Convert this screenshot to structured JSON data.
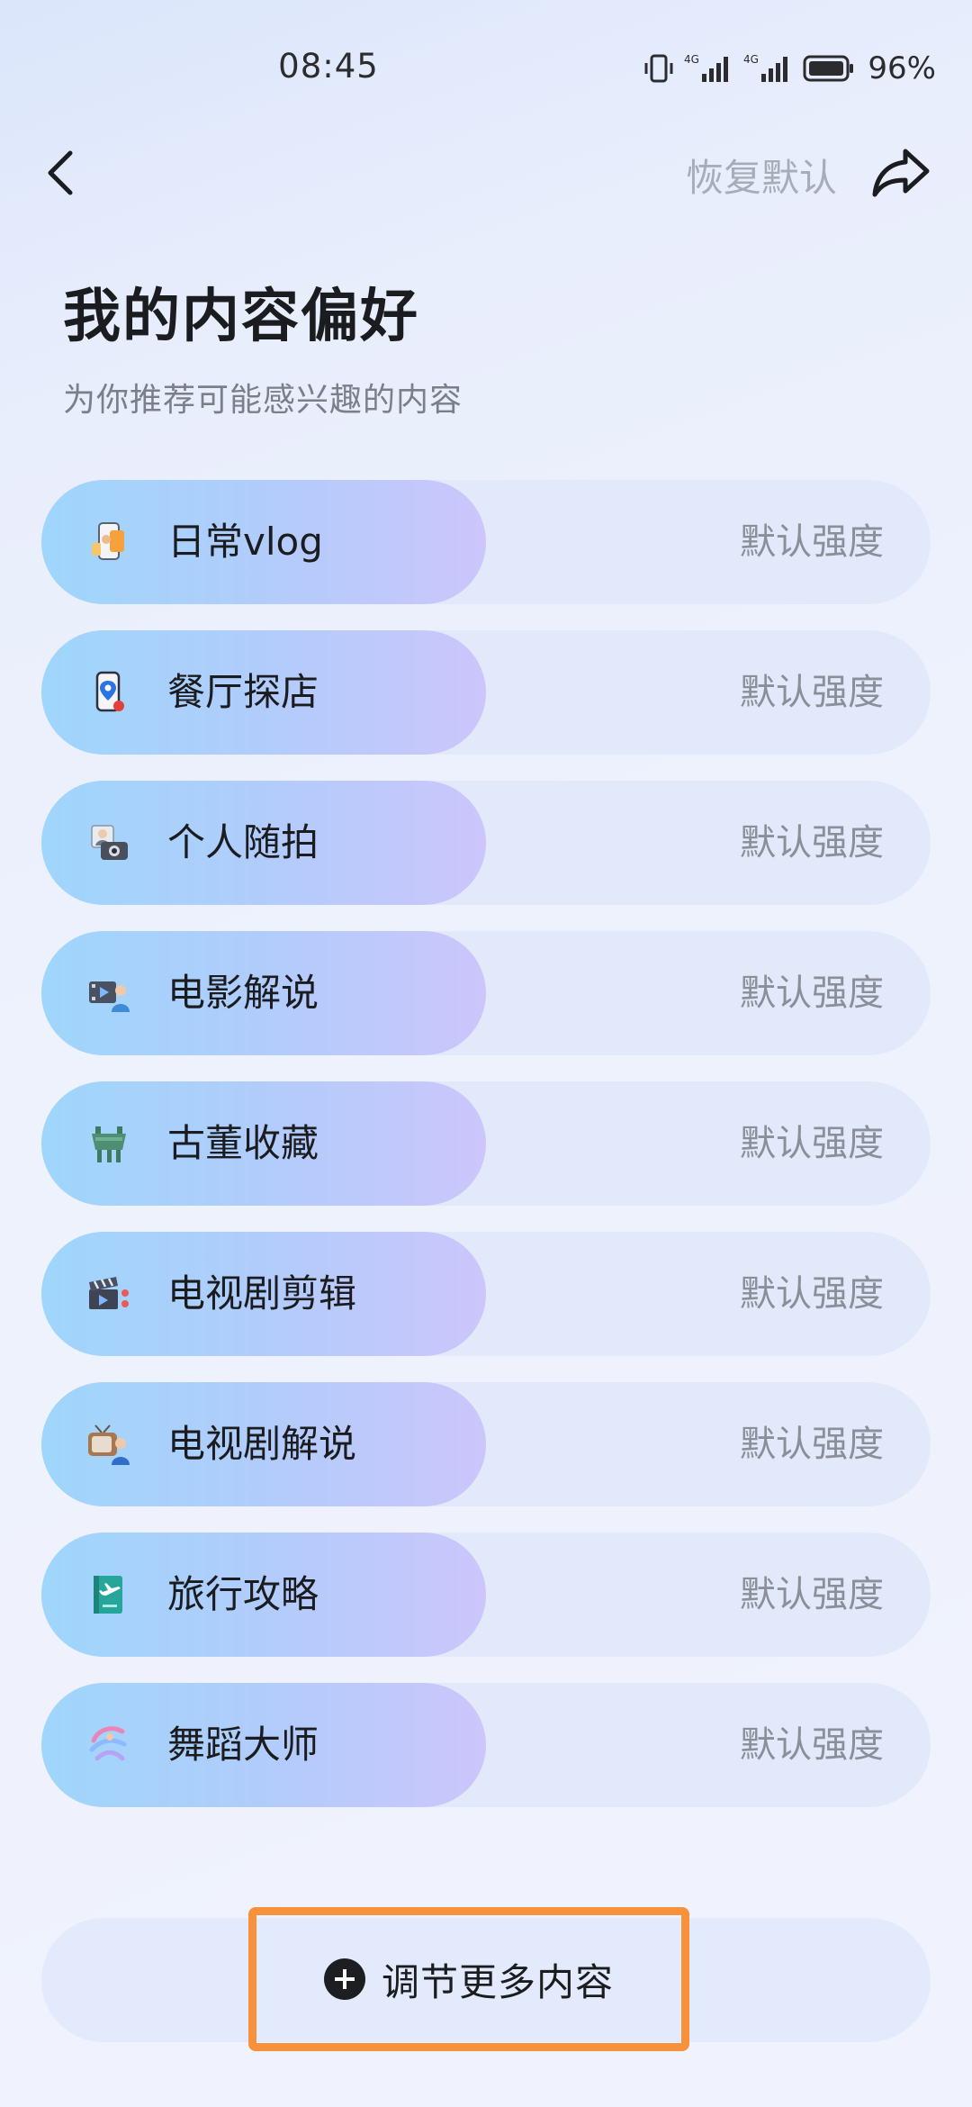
{
  "status_bar": {
    "time": "08:45",
    "network_1": "4G",
    "network_2": "4G",
    "battery_percent": "96%",
    "icons": [
      "vibrate-icon",
      "signal-4g-icon",
      "signal-4g-icon",
      "battery-icon"
    ]
  },
  "header": {
    "back_icon": "chevron-left-icon",
    "restore_label": "恢复默认",
    "share_icon": "share-icon"
  },
  "page": {
    "title": "我的内容偏好",
    "subtitle": "为你推荐可能感兴趣的内容"
  },
  "preferences": [
    {
      "label": "日常vlog",
      "level": "默认强度",
      "icon": "phone-vlog-icon",
      "fill_fraction": 0.5
    },
    {
      "label": "餐厅探店",
      "level": "默认强度",
      "icon": "map-pin-phone-icon",
      "fill_fraction": 0.5
    },
    {
      "label": "个人随拍",
      "level": "默认强度",
      "icon": "camera-portrait-icon",
      "fill_fraction": 0.5
    },
    {
      "label": "电影解说",
      "level": "默认强度",
      "icon": "film-presenter-icon",
      "fill_fraction": 0.5
    },
    {
      "label": "古董收藏",
      "level": "默认强度",
      "icon": "bronze-vessel-icon",
      "fill_fraction": 0.5
    },
    {
      "label": "电视剧剪辑",
      "level": "默认强度",
      "icon": "clapperboard-icon",
      "fill_fraction": 0.5
    },
    {
      "label": "电视剧解说",
      "level": "默认强度",
      "icon": "tv-presenter-icon",
      "fill_fraction": 0.5
    },
    {
      "label": "旅行攻略",
      "level": "默认强度",
      "icon": "travel-book-icon",
      "fill_fraction": 0.5
    },
    {
      "label": "舞蹈大师",
      "level": "默认强度",
      "icon": "dance-ribbon-icon",
      "fill_fraction": 0.5
    }
  ],
  "footer": {
    "more_label": "调节更多内容",
    "more_icon": "plus-circle-icon",
    "highlight_color": "#f7913b"
  },
  "colors": {
    "fill_start": "#9fd6fb",
    "fill_end": "#ccc6fb",
    "track": "#e1e9fb"
  }
}
